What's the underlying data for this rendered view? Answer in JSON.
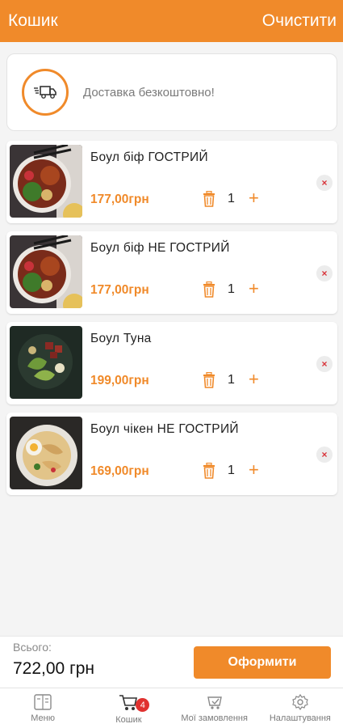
{
  "header": {
    "title": "Кошик",
    "clear_label": "Очистити"
  },
  "delivery": {
    "text": "Доставка безкоштовно!",
    "icon": "truck-icon"
  },
  "items": [
    {
      "name": "Боул біф ГОСТРИЙ",
      "price": "177,00грн",
      "qty": "1",
      "image": "beef-bowl"
    },
    {
      "name": "Боул біф НЕ ГОСТРИЙ",
      "price": "177,00грн",
      "qty": "1",
      "image": "beef-bowl"
    },
    {
      "name": "Боул Туна",
      "price": "199,00грн",
      "qty": "1",
      "image": "tuna-bowl"
    },
    {
      "name": "Боул чікен НЕ ГОСТРИЙ",
      "price": "169,00грн",
      "qty": "1",
      "image": "chicken-bowl"
    }
  ],
  "item_controls": {
    "plus": "+",
    "remove": "×"
  },
  "footer": {
    "total_label": "Всього:",
    "total_value": "722,00 грн",
    "checkout_label": "Оформити"
  },
  "tabs": [
    {
      "label": "Меню",
      "icon": "menu-icon"
    },
    {
      "label": "Кошик",
      "icon": "cart-icon",
      "badge": "4"
    },
    {
      "label": "Мої замовлення",
      "icon": "orders-icon"
    },
    {
      "label": "Налаштування",
      "icon": "gear-icon"
    }
  ],
  "colors": {
    "accent": "#f08a2a",
    "badge": "#e0312f",
    "remove": "#d8343a"
  }
}
